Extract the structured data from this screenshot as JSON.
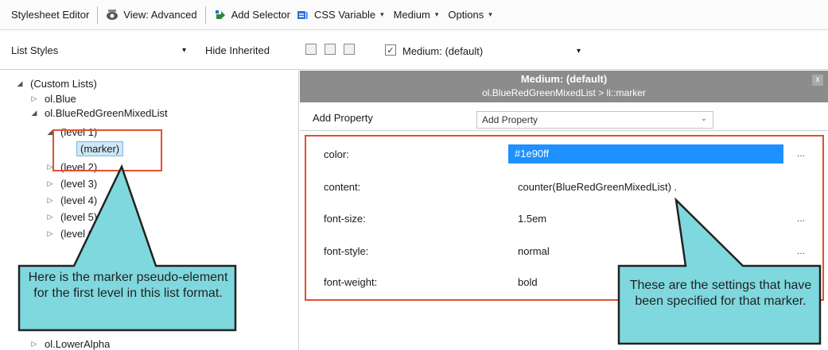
{
  "toolbar": {
    "title": "Stylesheet Editor",
    "view_label": "View: Advanced",
    "add_selector_label": "Add Selector",
    "css_variable_label": "CSS Variable",
    "medium_label": "Medium",
    "options_label": "Options"
  },
  "subbar": {
    "list_styles_value": "List Styles",
    "hide_inherited_label": "Hide Inherited",
    "medium_checkbox_checked": true,
    "medium_select_value": "Medium: (default)"
  },
  "tree": {
    "items": [
      {
        "label": "(Custom Lists)",
        "expander": "◢"
      },
      {
        "label": "ol.Blue",
        "expander": "▷"
      },
      {
        "label": "ol.BlueRedGreenMixedList",
        "expander": "◢"
      },
      {
        "label": "(level 1)",
        "expander": "◢"
      },
      {
        "label": "(marker)",
        "expander": ""
      },
      {
        "label": "(level 2)",
        "expander": "▷"
      },
      {
        "label": "(level 3)",
        "expander": "▷"
      },
      {
        "label": "(level 4)",
        "expander": "▷"
      },
      {
        "label": "(level 5)",
        "expander": "▷"
      },
      {
        "label": "(level 6)",
        "expander": "▷"
      },
      {
        "label": "ol.LowerAlpha",
        "expander": "▷"
      }
    ]
  },
  "panel": {
    "header_title": "Medium: (default)",
    "header_subtitle": "ol.BlueRedGreenMixedList > li::marker",
    "close_glyph": "x",
    "add_property_label": "Add Property",
    "add_property_placeholder": "Add Property",
    "more_glyph": "...",
    "properties": [
      {
        "name": "color:",
        "value": "#1e90ff"
      },
      {
        "name": "content:",
        "value": "counter(BlueRedGreenMixedList) ."
      },
      {
        "name": "font-size:",
        "value": "1.5em"
      },
      {
        "name": "font-style:",
        "value": "normal"
      },
      {
        "name": "font-weight:",
        "value": "bold"
      }
    ]
  },
  "callouts": {
    "left_text": "Here is the marker pseudo-element for the first level in this list format.",
    "right_text": "These are the settings that have been specified for that marker."
  },
  "colors": {
    "accent": "#1e90ff",
    "highlight_border": "#e0512f",
    "callout_fill": "#7fd8de",
    "header_bg": "#8c8c8c"
  }
}
